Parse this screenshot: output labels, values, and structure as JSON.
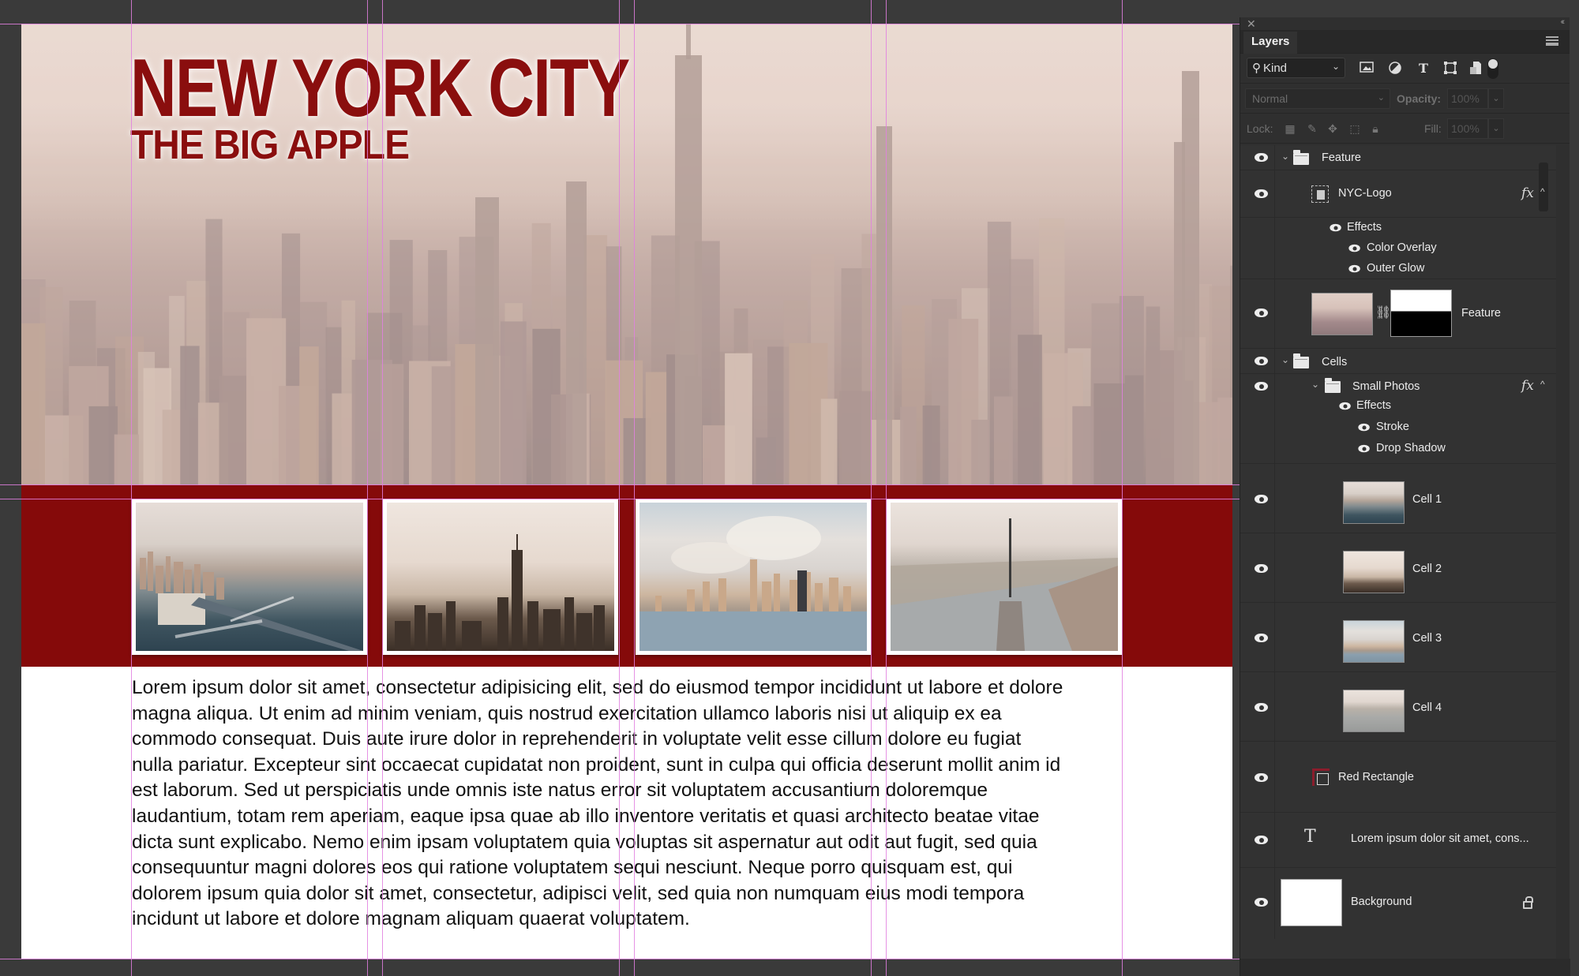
{
  "canvas": {
    "title_main": "NEW YORK CITY",
    "title_sub": "THE BIG APPLE",
    "brand_red": "#850a0a",
    "photos": [
      {
        "name": "Cell 1",
        "subject": "Brooklyn Bridge aerial"
      },
      {
        "name": "Cell 2",
        "subject": "One World Trade Center skyline"
      },
      {
        "name": "Cell 3",
        "subject": "Lower Manhattan from the water"
      },
      {
        "name": "Cell 4",
        "subject": "Spire over Hudson River"
      }
    ],
    "body_text": "Lorem ipsum dolor sit amet, consectetur adipisicing elit, sed do eiusmod tempor incididunt ut labore et dolore\nmagna aliqua. Ut enim ad minim veniam, quis nostrud exercitation ullamco laboris nisi ut aliquip ex ea\ncommodo consequat. Duis aute irure dolor in reprehenderit in voluptate velit esse cillum dolore eu fugiat\nnulla pariatur. Excepteur sint occaecat cupidatat non proident, sunt in culpa qui officia deserunt mollit anim id\nest laborum. Sed ut perspiciatis unde omnis iste natus error sit voluptatem accusantium doloremque\nlaudantium, totam rem aperiam, eaque ipsa quae ab illo inventore veritatis et quasi architecto beatae vitae\ndicta sunt explicabo. Nemo enim ipsam voluptatem quia voluptas sit aspernatur aut odit aut fugit, sed quia\nconsequuntur magni dolores eos qui ratione voluptatem sequi nesciunt. Neque porro quisquam est, qui\ndolorem ipsum quia dolor sit amet, consectetur, adipisci velit, sed quia non numquam eius modi tempora\nincidunt ut labore et dolore magnam aliquam quaerat voluptatem."
  },
  "panel": {
    "close_glyph": "✕",
    "collapse_glyph": "‹‹",
    "tab_label": "Layers",
    "filter": {
      "search_glyph": "⚲",
      "label": "Kind",
      "icons": [
        "image-filter-icon",
        "adjustment-filter-icon",
        "type-filter-icon",
        "shape-filter-icon",
        "smart-object-filter-icon"
      ]
    },
    "blend_mode": "Normal",
    "opacity_label": "Opacity:",
    "opacity_value": "100%",
    "lock_label": "Lock:",
    "fill_label": "Fill:",
    "fill_value": "100%",
    "layers": {
      "feature_group": "Feature",
      "nyc_logo": "NYC-Logo",
      "nyc_effects": "Effects",
      "nyc_color_overlay": "Color Overlay",
      "nyc_outer_glow": "Outer Glow",
      "feature_layer": "Feature",
      "cells_group": "Cells",
      "small_photos_group": "Small Photos",
      "sp_effects": "Effects",
      "sp_stroke": "Stroke",
      "sp_drop_shadow": "Drop Shadow",
      "cell1": "Cell 1",
      "cell2": "Cell 2",
      "cell3": "Cell 3",
      "cell4": "Cell 4",
      "red_rectangle": "Red Rectangle",
      "text_layer": "Lorem ipsum dolor sit amet, cons...",
      "background": "Background"
    },
    "fx_label": "fx",
    "type_glyph": "T",
    "link_glyph": "⛓"
  }
}
